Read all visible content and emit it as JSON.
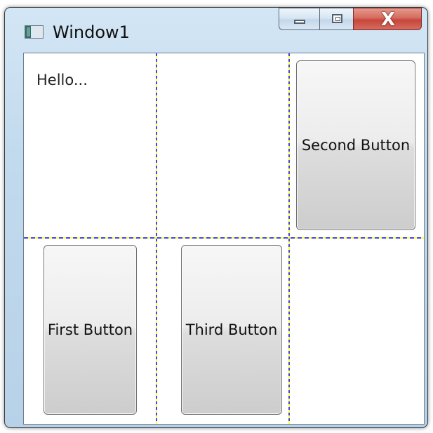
{
  "window": {
    "title": "Window1"
  },
  "caption_buttons": {
    "minimize_icon": "minimize-icon",
    "maximize_icon": "maximize-icon",
    "close_icon": "close-icon"
  },
  "content": {
    "hello_text": "Hello...",
    "buttons": {
      "second": "Second Button",
      "first": "First Button",
      "third": "Third Button"
    }
  },
  "colors": {
    "grid_line_blue": "#3e46f0",
    "grid_line_yellow": "#ffff33",
    "window_frame": "#c2daee",
    "close_button": "#c7463b"
  }
}
